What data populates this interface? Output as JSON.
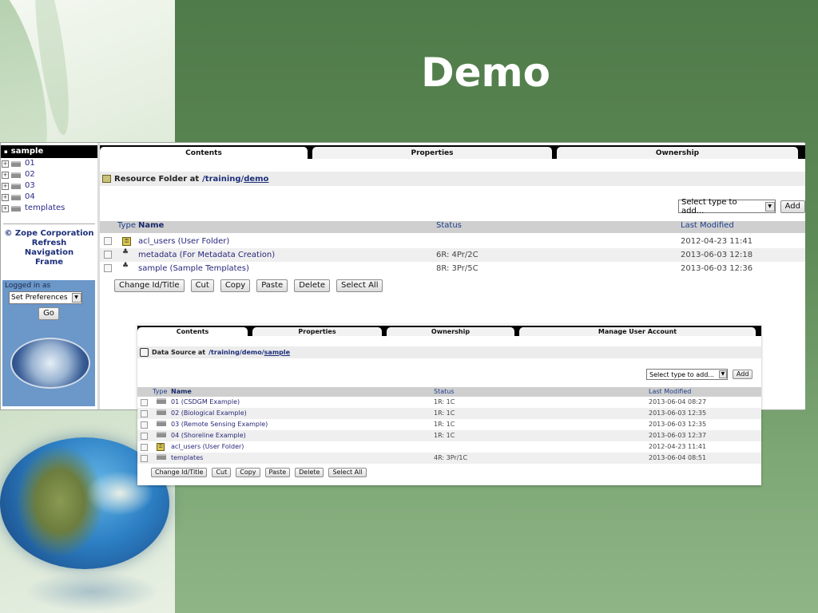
{
  "slide": {
    "title": "Demo"
  },
  "zmi_main": {
    "nav": {
      "root": "sample",
      "items": [
        {
          "label": "01"
        },
        {
          "label": "02"
        },
        {
          "label": "03"
        },
        {
          "label": "04"
        },
        {
          "label": "templates"
        }
      ],
      "links": [
        "© Zope Corporation",
        "Refresh",
        "Navigation",
        "Frame"
      ],
      "logged_in_label": "Logged in as",
      "preferences_select": "Set Preferences",
      "go_button": "Go"
    },
    "tabs": [
      "Contents",
      "Properties",
      "Ownership"
    ],
    "location": {
      "prefix": "Resource Folder at",
      "path_plain": "/training/",
      "path_link": "demo"
    },
    "add": {
      "select_value": "Select type to add...",
      "button": "Add"
    },
    "columns": {
      "type": "Type",
      "name": "Name",
      "status": "Status",
      "modified": "Last Modified"
    },
    "rows": [
      {
        "icon": "user-folder",
        "name": "acl_users (User Folder)",
        "status": "",
        "modified": "2012-04-23 11:41"
      },
      {
        "icon": "metadata",
        "name": "metadata (For Metadata Creation)",
        "status": "6R: 4Pr/2C",
        "modified": "2013-06-03 12:18"
      },
      {
        "icon": "metadata",
        "name": "sample (Sample Templates)",
        "status": "8R: 3Pr/5C",
        "modified": "2013-06-03 12:36"
      }
    ],
    "actions": [
      "Change Id/Title",
      "Cut",
      "Copy",
      "Paste",
      "Delete",
      "Select All"
    ]
  },
  "zmi_sample": {
    "tabs": [
      "Contents",
      "Properties",
      "Ownership",
      "Manage User Account"
    ],
    "location": {
      "prefix": "Data Source at",
      "path_plain": "/training/demo/",
      "path_link": "sample"
    },
    "add": {
      "select_value": "Select type to add...",
      "button": "Add"
    },
    "columns": {
      "type": "Type",
      "name": "Name",
      "status": "Status",
      "modified": "Last Modified"
    },
    "rows": [
      {
        "icon": "folder",
        "name": "01 (CSDGM Example)",
        "status": "1R: 1C",
        "modified": "2013-06-04 08:27"
      },
      {
        "icon": "folder",
        "name": "02 (Biological Example)",
        "status": "1R: 1C",
        "modified": "2013-06-03 12:35"
      },
      {
        "icon": "folder",
        "name": "03 (Remote Sensing Example)",
        "status": "1R: 1C",
        "modified": "2013-06-03 12:35"
      },
      {
        "icon": "folder",
        "name": "04 (Shoreline Example)",
        "status": "1R: 1C",
        "modified": "2013-06-03 12:37"
      },
      {
        "icon": "user-folder",
        "name": "acl_users (User Folder)",
        "status": "",
        "modified": "2012-04-23 11:41"
      },
      {
        "icon": "folder",
        "name": "templates",
        "status": "4R: 3Pr/1C",
        "modified": "2013-06-04 08:51"
      }
    ],
    "actions": [
      "Change Id/Title",
      "Cut",
      "Copy",
      "Paste",
      "Delete",
      "Select All"
    ]
  }
}
